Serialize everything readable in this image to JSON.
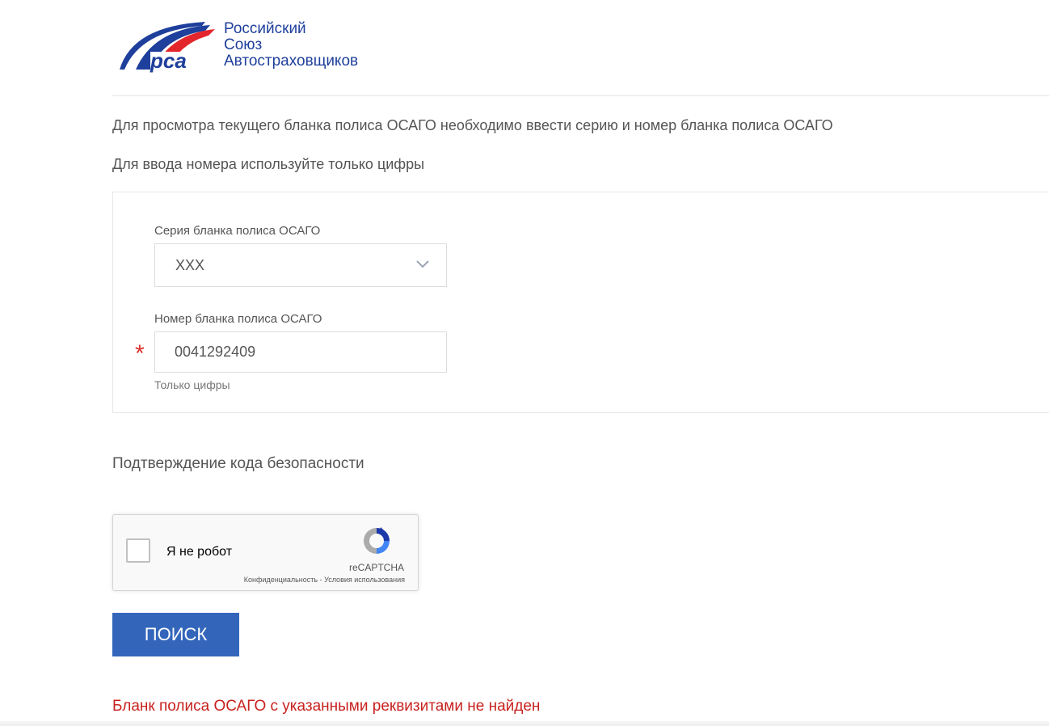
{
  "header": {
    "logo_mark": "рса",
    "logo_lines": [
      "Российский",
      "Союз",
      "Автостраховщиков"
    ]
  },
  "intro": {
    "line1": "Для просмотра текущего бланка полиса ОСАГО необходимо ввести серию и номер бланка полиса ОСАГО",
    "line2": "Для ввода номера используйте только цифры"
  },
  "form": {
    "series_label": "Серия бланка полиса ОСАГО",
    "series_value": "XXX",
    "number_label": "Номер бланка полиса ОСАГО",
    "number_value": "0041292409",
    "required_mark": "*",
    "number_hint": "Только цифры"
  },
  "captcha": {
    "heading": "Подтверждение кода безопасности",
    "label": "Я не робот",
    "brand": "reCAPTCHA",
    "privacy_link": "Конфиденциальность",
    "separator": " - ",
    "terms_link": "Условия использования"
  },
  "search_button": {
    "label": "ПОИСК"
  },
  "result": {
    "error": "Бланк полиса ОСАГО с указанными реквизитами не найден"
  },
  "colors": {
    "accent_button": "#3366bb",
    "error_text": "#c7221f",
    "logo_blue": "#1e3f9b",
    "logo_red": "#e3262c"
  },
  "icons": {
    "select_arrow": "chevron-down-icon",
    "recaptcha": "recaptcha-logo-icon"
  }
}
